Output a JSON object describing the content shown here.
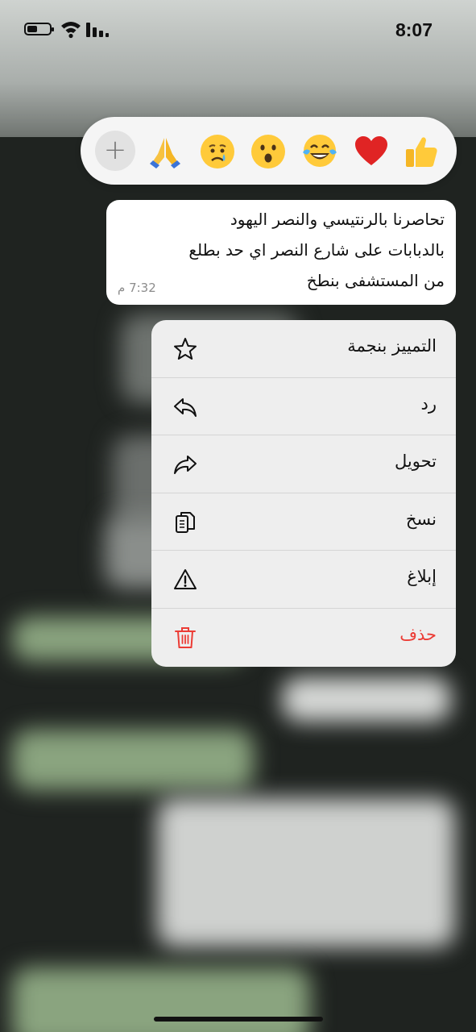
{
  "status_bar": {
    "time": "8:07"
  },
  "reactions": {
    "plus_label": "+",
    "emojis": [
      {
        "name": "folded-hands"
      },
      {
        "name": "crying-face"
      },
      {
        "name": "surprised-face"
      },
      {
        "name": "tears-of-joy"
      },
      {
        "name": "red-heart"
      },
      {
        "name": "thumbs-up"
      }
    ]
  },
  "message": {
    "lines": [
      "تحاصرنا بالرنتيسي والنصر اليهود",
      "بالدبابات على شارع النصر اي حد بطلع",
      "من المستشفى بنطخ"
    ],
    "time": "7:32 م"
  },
  "menu": {
    "items": [
      {
        "label": "التمييز بنجمة",
        "icon": "star-icon"
      },
      {
        "label": "رد",
        "icon": "reply-icon"
      },
      {
        "label": "تحويل",
        "icon": "forward-icon"
      },
      {
        "label": "نسخ",
        "icon": "copy-icon"
      },
      {
        "label": "إبلاغ",
        "icon": "warning-icon"
      },
      {
        "label": "حذف",
        "icon": "trash-icon",
        "color": "#ec3c35"
      }
    ]
  }
}
